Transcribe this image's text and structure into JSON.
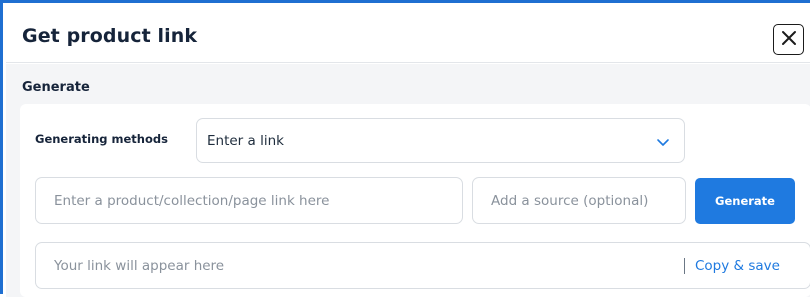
{
  "dialog": {
    "title": "Get product link",
    "close_icon": "close-icon"
  },
  "section": {
    "title": "Generate"
  },
  "form": {
    "method_label": "Generating methods",
    "method_select": {
      "value": "Enter a link",
      "icon": "chevron-down-icon"
    },
    "link_input": {
      "placeholder": "Enter a product/collection/page link here"
    },
    "source_input": {
      "placeholder": "Add a source (optional)"
    },
    "generate_label": "Generate"
  },
  "result": {
    "placeholder": "Your link will appear here",
    "copy_label": "Copy & save"
  },
  "colors": {
    "accent": "#1f7ae0",
    "frame_border": "#1f6fd1",
    "body_bg": "#f4f5f7"
  }
}
